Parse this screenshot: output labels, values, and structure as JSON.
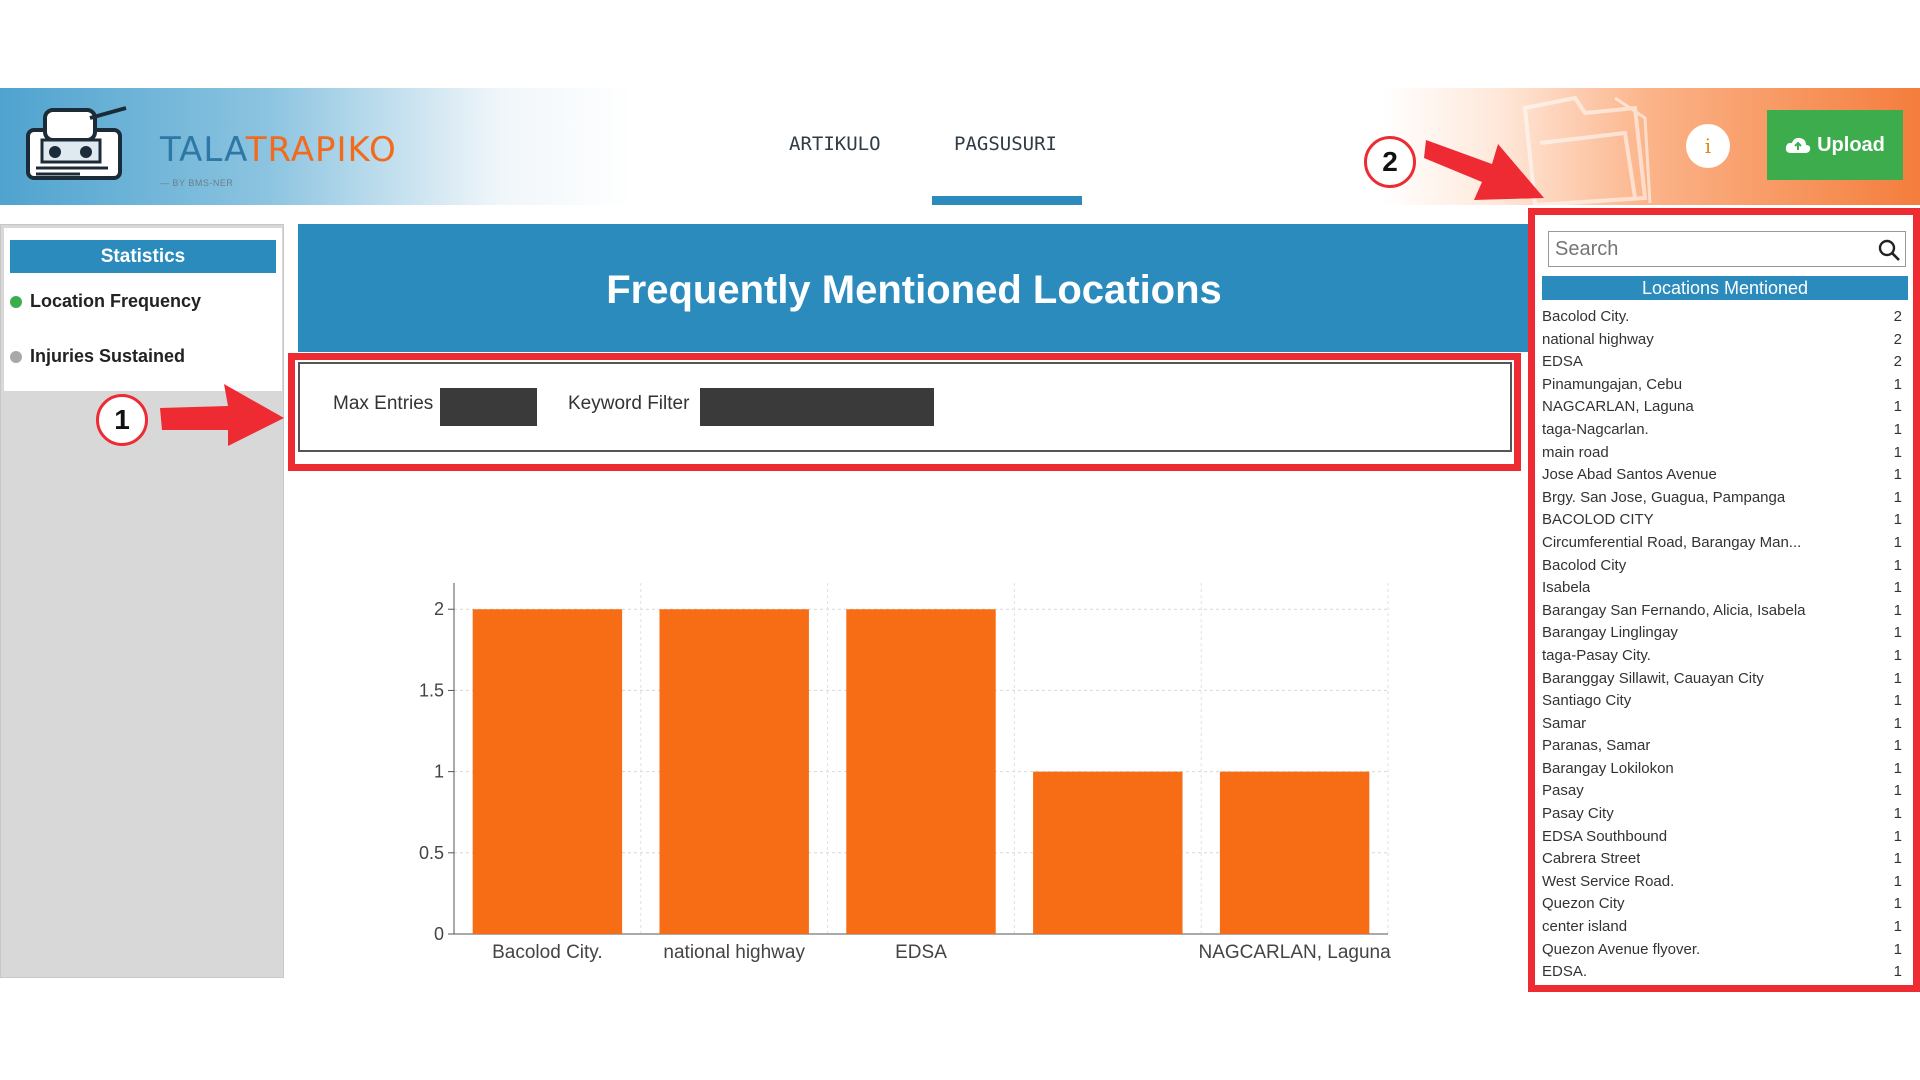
{
  "header": {
    "logo_text_part1": "TALA",
    "logo_text_part2": "TRAPIKO",
    "logo_subtitle": "— BY BMS-NER",
    "tabs": [
      {
        "label": "ARTIKULO",
        "active": false
      },
      {
        "label": "PAGSUSURI",
        "active": true
      }
    ],
    "info_label": "i",
    "upload_label": "Upload"
  },
  "sidebar": {
    "title": "Statistics",
    "items": [
      {
        "label": "Location Frequency",
        "status_color": "#3cac4c",
        "active": true
      },
      {
        "label": "Injuries Sustained",
        "status_color": "#a9a9a9",
        "active": false
      }
    ]
  },
  "main": {
    "title": "Frequently Mentioned Locations",
    "filters": {
      "max_entries_label": "Max Entries",
      "max_entries_value": "",
      "keyword_filter_label": "Keyword Filter",
      "keyword_filter_value": ""
    }
  },
  "chart_data": {
    "type": "bar",
    "categories": [
      "Bacolod City.",
      "national highway",
      "EDSA",
      "Pinamungajan, Cebu",
      "NAGCARLAN, Laguna"
    ],
    "tick_labels": [
      "Bacolod City.",
      "national highway",
      "EDSA",
      "",
      "NAGCARLAN, Laguna"
    ],
    "values": [
      2,
      2,
      2,
      1,
      1
    ],
    "ylim": [
      0,
      2.1
    ],
    "yticks": [
      "0",
      "0.5",
      "1",
      "1.5",
      "2"
    ],
    "ytick_values": [
      0,
      0.5,
      1,
      1.5,
      2
    ],
    "bar_color": "#f76d16",
    "grid": true
  },
  "locations_panel": {
    "search_placeholder": "Search",
    "header": "Locations Mentioned",
    "items": [
      {
        "name": "Bacolod City.",
        "count": "2"
      },
      {
        "name": "national highway",
        "count": "2"
      },
      {
        "name": "EDSA",
        "count": "2"
      },
      {
        "name": "Pinamungajan, Cebu",
        "count": "1"
      },
      {
        "name": "NAGCARLAN, Laguna",
        "count": "1"
      },
      {
        "name": "taga-Nagcarlan.",
        "count": "1"
      },
      {
        "name": "main road",
        "count": "1"
      },
      {
        "name": "Jose Abad Santos Avenue",
        "count": "1"
      },
      {
        "name": "Brgy. San Jose, Guagua, Pampanga",
        "count": "1"
      },
      {
        "name": "BACOLOD CITY",
        "count": "1"
      },
      {
        "name": "Circumferential Road, Barangay Man...",
        "count": "1"
      },
      {
        "name": "Bacolod City",
        "count": "1"
      },
      {
        "name": "Isabela",
        "count": "1"
      },
      {
        "name": "Barangay San Fernando, Alicia, Isabela",
        "count": "1"
      },
      {
        "name": "Barangay Linglingay",
        "count": "1"
      },
      {
        "name": "taga-Pasay City.",
        "count": "1"
      },
      {
        "name": "Baranggay Sillawit, Cauayan City",
        "count": "1"
      },
      {
        "name": "Santiago City",
        "count": "1"
      },
      {
        "name": "Samar",
        "count": "1"
      },
      {
        "name": "Paranas, Samar",
        "count": "1"
      },
      {
        "name": "Barangay Lokilokon",
        "count": "1"
      },
      {
        "name": "Pasay",
        "count": "1"
      },
      {
        "name": "Pasay City",
        "count": "1"
      },
      {
        "name": "EDSA Southbound",
        "count": "1"
      },
      {
        "name": "Cabrera Street",
        "count": "1"
      },
      {
        "name": "West Service Road.",
        "count": "1"
      },
      {
        "name": "Quezon City",
        "count": "1"
      },
      {
        "name": "center island",
        "count": "1"
      },
      {
        "name": "Quezon Avenue flyover.",
        "count": "1"
      },
      {
        "name": "EDSA.",
        "count": "1"
      }
    ]
  },
  "annotations": {
    "marker_1": "1",
    "marker_2": "2",
    "color": "#ee2a33"
  }
}
